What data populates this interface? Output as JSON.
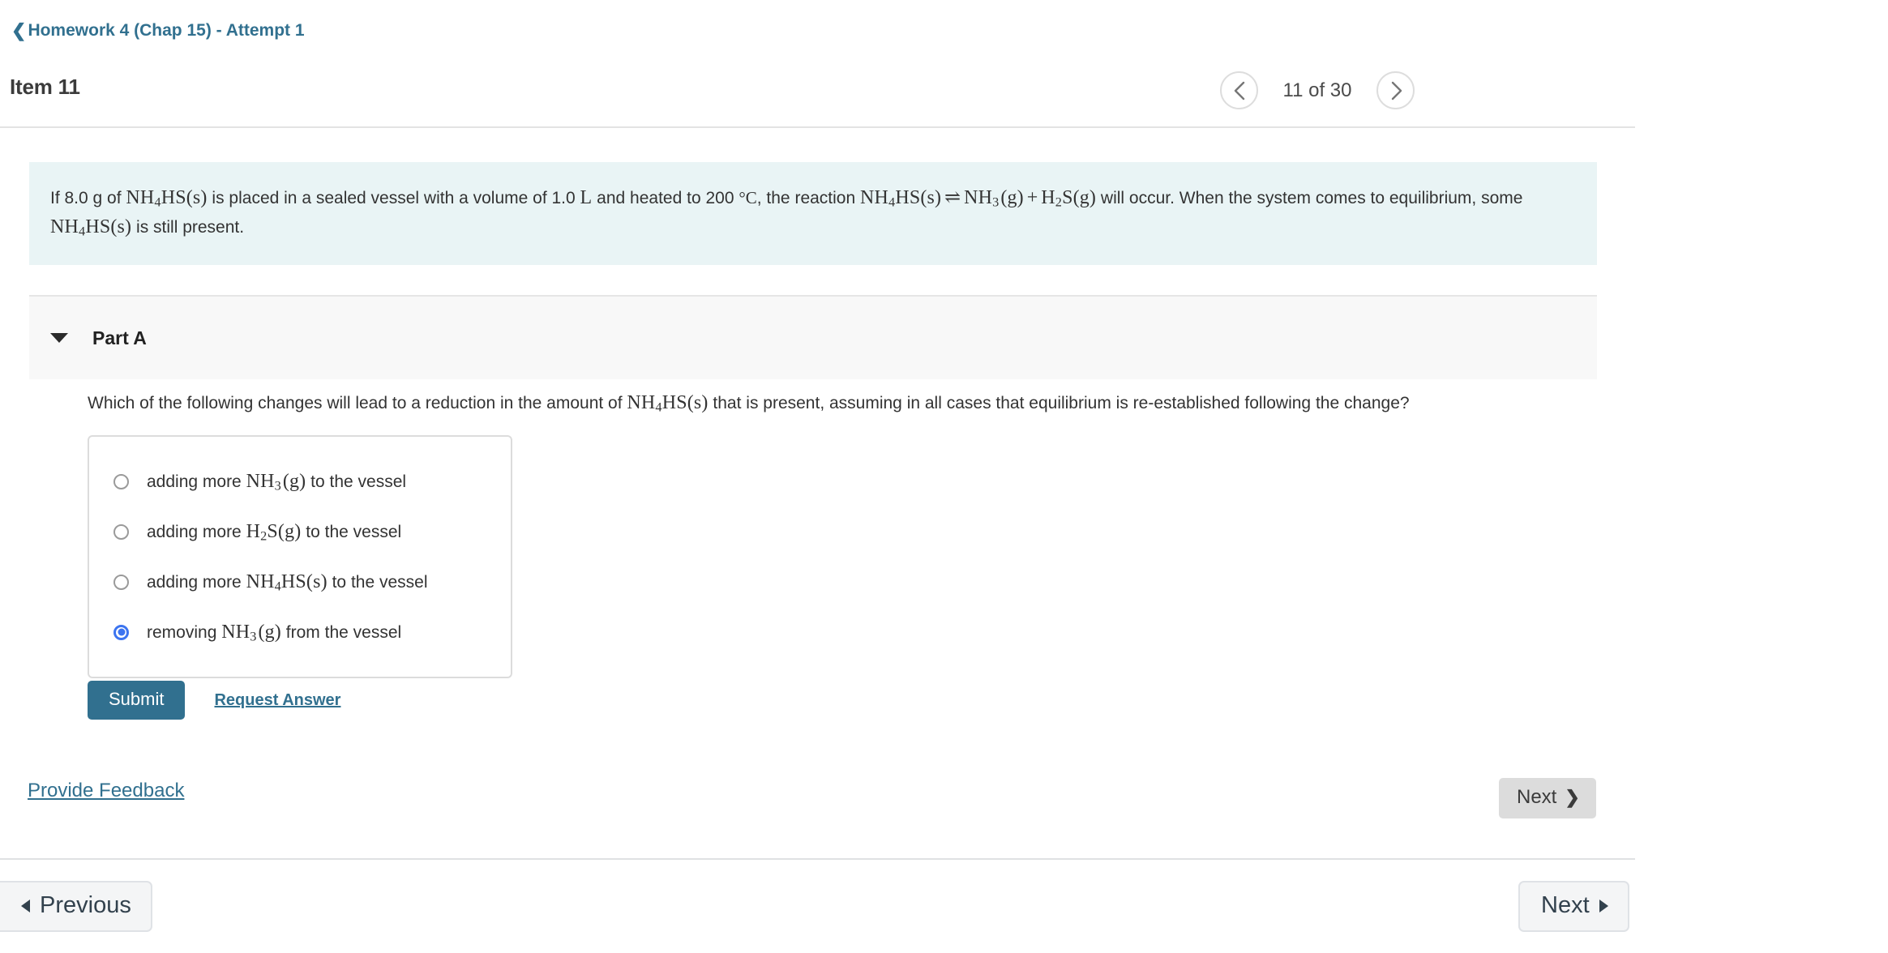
{
  "breadcrumb": {
    "back_icon": "chevron-left-icon",
    "label": "Homework 4 (Chap 15) - Attempt 1"
  },
  "header": {
    "item_title": "Item 11",
    "pager": {
      "prev_icon": "chevron-left-icon",
      "next_icon": "chevron-right-icon",
      "position_label": "11 of 30",
      "current": 11,
      "total": 30
    }
  },
  "statement": {
    "background_color": "#e9f4f5",
    "segments": [
      {
        "type": "text",
        "text": "If 8.0 g of "
      },
      {
        "type": "math",
        "text": "NH4HS(s)"
      },
      {
        "type": "text",
        "text": " is placed in a sealed vessel with a volume of 1.0 "
      },
      {
        "type": "math",
        "text": "L"
      },
      {
        "type": "text",
        "text": " and heated to 200 °C, the reaction "
      },
      {
        "type": "math",
        "text": "NH4HS(s) ⇌ NH3(g) + H2S(g)"
      },
      {
        "type": "text",
        "text": " will occur. When the system comes to equilibrium, some "
      },
      {
        "type": "math",
        "text": "NH4HS(s)"
      },
      {
        "type": "text",
        "text": " is still present."
      }
    ],
    "plain_text": "If 8.0 g of NH4HS(s) is placed in a sealed vessel with a volume of 1.0 L and heated to 200 °C, the reaction NH4HS(s) ⇌ NH3(g) + H2S(g) will occur. When the system comes to equilibrium, some NH4HS(s) is still present."
  },
  "part": {
    "caret_icon": "caret-down-icon",
    "label": "Part A",
    "question_plain": "Which of the following changes will lead to a reduction in the amount of NH4HS(s) that is present, assuming in all cases that equilibrium is re-established following the change?",
    "question_prefix": "Which of the following changes will lead to a reduction in the amount of ",
    "question_suffix": " that is present, assuming in all cases that equilibrium is re-established following the change?"
  },
  "options": [
    {
      "id": "opt-1",
      "prefix": "adding more ",
      "suffix": " to the vessel",
      "formula": "NH3(g)",
      "selected": false
    },
    {
      "id": "opt-2",
      "prefix": "adding more ",
      "suffix": " to the vessel",
      "formula": "H2S(g)",
      "selected": false
    },
    {
      "id": "opt-3",
      "prefix": "adding more ",
      "suffix": " to the vessel",
      "formula": "NH4HS(s)",
      "selected": false
    },
    {
      "id": "opt-4",
      "prefix": "removing ",
      "suffix": " from the vessel",
      "formula": "NH3(g)",
      "selected": true
    }
  ],
  "actions": {
    "submit_label": "Submit",
    "submit_color": "#31708f",
    "request_answer_label": "Request Answer",
    "provide_feedback_label": "Provide Feedback",
    "next_inline_label": "Next",
    "next_inline_icon": "chevron-right-icon"
  },
  "bottom_nav": {
    "previous_label": "Previous",
    "previous_icon": "triangle-left-icon",
    "next_label": "Next",
    "next_icon": "triangle-right-icon"
  },
  "colors": {
    "link": "#31708f",
    "radio_selected": "#3c74f0",
    "statement_bg": "#e9f4f5",
    "part_bg": "#f8f8f8"
  }
}
